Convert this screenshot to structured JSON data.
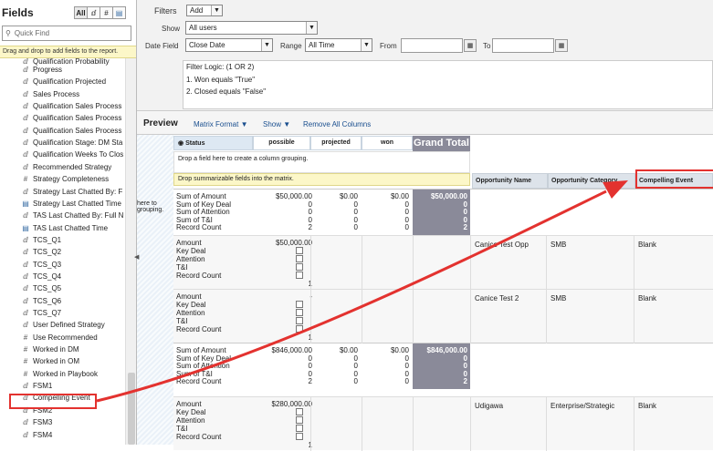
{
  "fields_panel": {
    "title": "Fields",
    "tabs": [
      "All",
      "ⅆ",
      "#",
      "▤"
    ],
    "quick_find_placeholder": "Quick Find",
    "hint": "Drag and drop to add fields to the report.",
    "partial_item": "Qualification Probability",
    "items": [
      {
        "label": "Progress",
        "icon": "a"
      },
      {
        "label": "Qualification Projected",
        "icon": "a"
      },
      {
        "label": "Sales Process",
        "icon": "a"
      },
      {
        "label": "Qualification Sales Process",
        "icon": "a"
      },
      {
        "label": "Qualification Sales Process",
        "icon": "a"
      },
      {
        "label": "Qualification Sales Process",
        "icon": "a"
      },
      {
        "label": "Qualification Stage: DM Sta",
        "icon": "a"
      },
      {
        "label": "Qualification Weeks To Clos",
        "icon": "a"
      },
      {
        "label": "Recommended Strategy",
        "icon": "a"
      },
      {
        "label": "Strategy Completeness",
        "icon": "#"
      },
      {
        "label": "Strategy Last Chatted By: F",
        "icon": "a"
      },
      {
        "label": "Strategy Last Chatted Time",
        "icon": "d"
      },
      {
        "label": "TAS Last Chatted By: Full N",
        "icon": "a"
      },
      {
        "label": "TAS Last Chatted Time",
        "icon": "d"
      },
      {
        "label": "TCS_Q1",
        "icon": "a"
      },
      {
        "label": "TCS_Q2",
        "icon": "a"
      },
      {
        "label": "TCS_Q3",
        "icon": "a"
      },
      {
        "label": "TCS_Q4",
        "icon": "a"
      },
      {
        "label": "TCS_Q5",
        "icon": "a"
      },
      {
        "label": "TCS_Q6",
        "icon": "a"
      },
      {
        "label": "TCS_Q7",
        "icon": "a"
      },
      {
        "label": "User Defined Strategy",
        "icon": "a"
      },
      {
        "label": "Use Recommended",
        "icon": "#"
      },
      {
        "label": "Worked in DM",
        "icon": "#"
      },
      {
        "label": "Worked in OM",
        "icon": "#"
      },
      {
        "label": "Worked in Playbook",
        "icon": "#"
      },
      {
        "label": "FSM1",
        "icon": "a"
      },
      {
        "label": "Compelling Event",
        "icon": "a"
      },
      {
        "label": "FSM2",
        "icon": "a"
      },
      {
        "label": "FSM3",
        "icon": "a"
      },
      {
        "label": "FSM4",
        "icon": "a"
      }
    ]
  },
  "filters": {
    "filters_label": "Filters",
    "add_label": "Add",
    "show_label": "Show",
    "show_value": "All users",
    "date_field_label": "Date Field",
    "date_field_value": "Close Date",
    "range_label": "Range",
    "range_value": "All Time",
    "from_label": "From",
    "to_label": "To",
    "filter_logic": "Filter Logic: (1 OR 2)",
    "filter1": "1. Won equals \"True\"",
    "filter2": "2. Closed equals \"False\""
  },
  "preview": {
    "title": "Preview",
    "matrix_format": "Matrix Format",
    "show": "Show",
    "remove_all": "Remove All Columns",
    "status_header": "Status",
    "col_headers": [
      "possible",
      "projected",
      "won"
    ],
    "grand_total": "Grand Total",
    "drop_column": "Drop a field here to create a column grouping.",
    "drop_summary": "Drop summarizable fields into the matrix.",
    "side_text": "here to grouping.",
    "detail_headers": [
      "Opportunity Name",
      "Opportunity Category",
      "Compelling Event"
    ],
    "groups": [
      {
        "labels": [
          "Sum of Amount",
          "Sum of Key Deal",
          "Sum of Attention",
          "Sum of T&I",
          "Record Count"
        ],
        "possible": [
          "$50,000.00",
          "0",
          "0",
          "0",
          "2"
        ],
        "projected": [
          "$0.00",
          "0",
          "0",
          "0",
          "0"
        ],
        "won": [
          "$0.00",
          "0",
          "0",
          "0",
          "0"
        ],
        "grand": [
          "$50,000.00",
          "0",
          "0",
          "0",
          "2"
        ]
      },
      {
        "labels": [
          "Sum of Amount",
          "Sum of Key Deal",
          "Sum of Attention",
          "Sum of T&I",
          "Record Count"
        ],
        "possible": [
          "$846,000.00",
          "0",
          "0",
          "0",
          "2"
        ],
        "projected": [
          "$0.00",
          "0",
          "0",
          "0",
          "0"
        ],
        "won": [
          "$0.00",
          "0",
          "0",
          "0",
          "0"
        ],
        "grand": [
          "$846,000.00",
          "0",
          "0",
          "0",
          "2"
        ]
      }
    ],
    "details": [
      {
        "labels": [
          "Amount",
          "Key Deal",
          "Attention",
          "T&I",
          "Record Count"
        ],
        "amount": "$50,000.00",
        "count": "1",
        "name": "Canice Test Opp",
        "category": "SMB",
        "event": "Blank"
      },
      {
        "labels": [
          "Amount",
          "Key Deal",
          "Attention",
          "T&I",
          "Record Count"
        ],
        "amount": "-",
        "count": "1",
        "name": "Canice Test 2",
        "category": "SMB",
        "event": "Blank"
      },
      {
        "labels": [
          "Amount",
          "Key Deal",
          "Attention",
          "T&I",
          "Record Count"
        ],
        "amount": "$280,000.00",
        "count": "1",
        "name": "Udigawa",
        "category": "Enterprise/Strategic",
        "event": "Blank"
      }
    ]
  },
  "colors": {
    "highlight": "#e3322f",
    "grand_total_bg": "#8a8a99",
    "hint_bg": "#fcf7c8"
  }
}
